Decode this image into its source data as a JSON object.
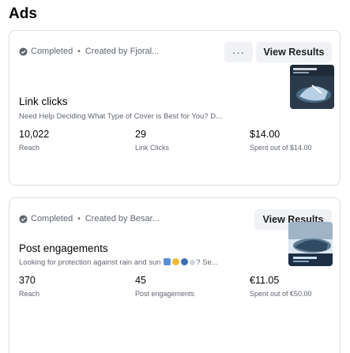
{
  "section_title": "Ads",
  "ads": [
    {
      "status": "Completed",
      "created_by": "Created by Fjoral...",
      "more_label": "···",
      "view_results_label": "View Results",
      "title": "Link clicks",
      "description": "Need Help Deciding What Type of Cover is Best for You? D...",
      "stats": [
        {
          "value": "10,022",
          "label": "Reach"
        },
        {
          "value": "29",
          "label": "Link Clicks"
        },
        {
          "value": "$14.00",
          "label": "Spent out of $14.00"
        }
      ]
    },
    {
      "status": "Completed",
      "created_by": "Created by Besar...",
      "view_results_label": "View Results",
      "title": "Post engagements",
      "description_prefix": "Looking for protection against rain and sun",
      "description_suffix": "? Se...",
      "stats": [
        {
          "value": "370",
          "label": "Reach"
        },
        {
          "value": "45",
          "label": "Post engagements"
        },
        {
          "value": "€11.05",
          "label": "Spent out of €50.00"
        }
      ]
    }
  ],
  "icons": {
    "status": "check-circle-icon",
    "thumbnail_1": "car-cover-thumbnail",
    "thumbnail_2": "car-cover-thumbnail",
    "emojis": [
      "rain-cloud-emoji",
      "sun-emoji",
      "globe-emoji",
      "sparkle-emoji"
    ]
  },
  "colors": {
    "button_bg": "#f0f2f5",
    "border": "#dadde1",
    "muted_text": "#606770"
  }
}
